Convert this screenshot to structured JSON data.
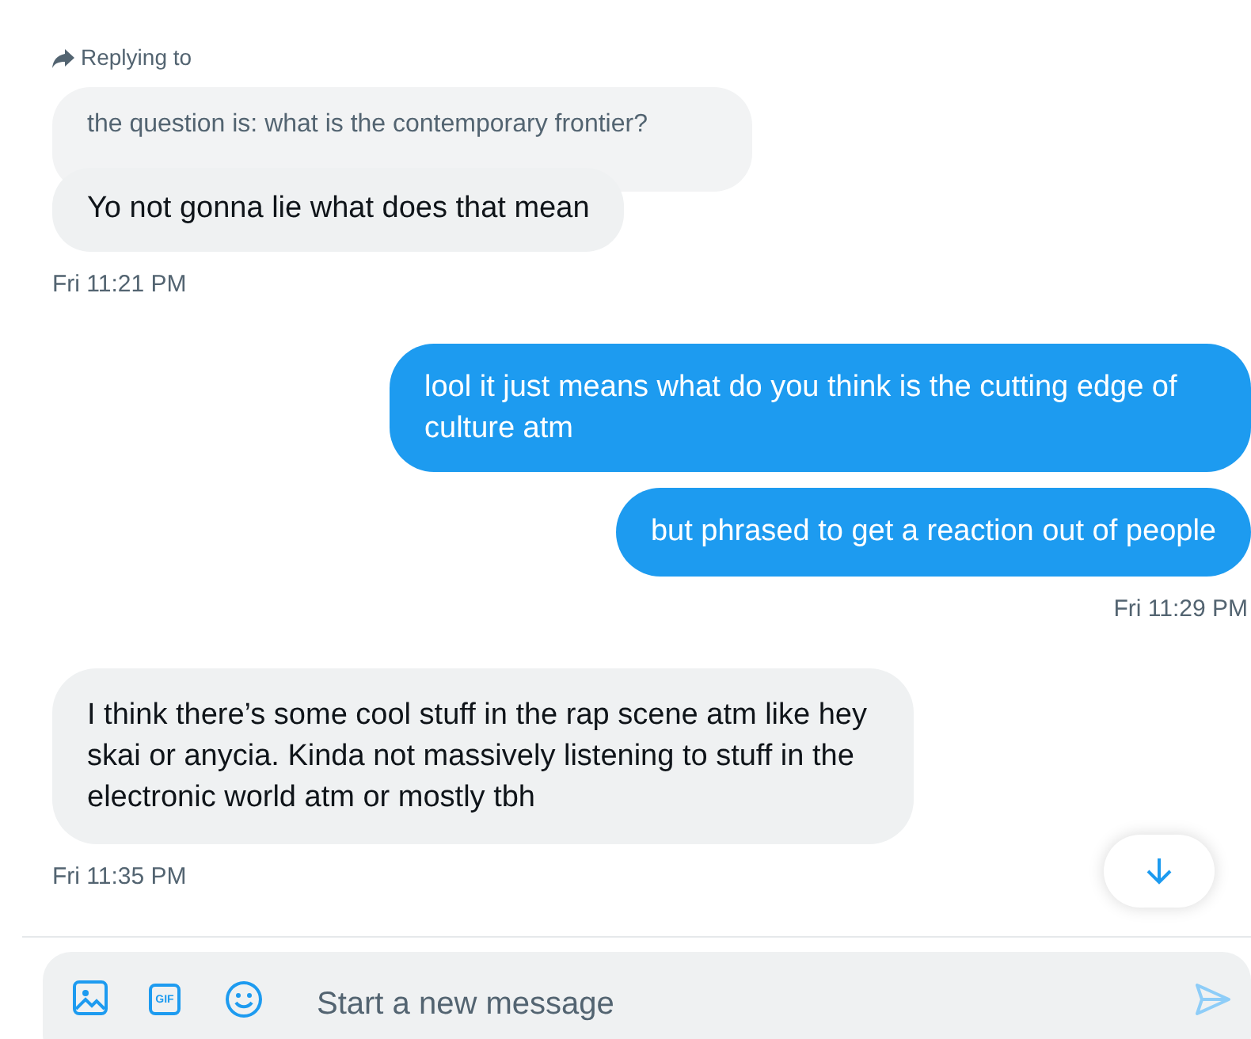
{
  "conversation": [
    {
      "kind": "reply",
      "label": "Replying to",
      "quoted": "the question is: what is the contemporary frontier?",
      "text": "Yo not gonna lie what does that mean"
    },
    {
      "kind": "time",
      "text": "Fri 11:21 PM"
    },
    {
      "kind": "sent",
      "text": "lool it just means what do you think is the cutting edge of culture atm"
    },
    {
      "kind": "sent",
      "text": "but phrased to get a reaction out of people"
    },
    {
      "kind": "time",
      "text": "Fri 11:29 PM"
    },
    {
      "kind": "received",
      "text": "I think there’s some cool stuff in the rap scene atm like hey skai or anycia. Kinda not massively listening to stuff in the electronic world atm or mostly tbh"
    },
    {
      "kind": "time",
      "text": "Fri 11:35 PM"
    }
  ],
  "composer": {
    "gif_label": "GIF",
    "placeholder": "Start a new message"
  }
}
